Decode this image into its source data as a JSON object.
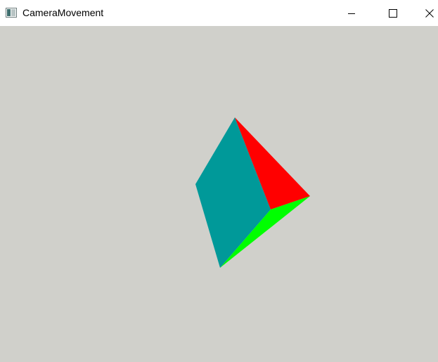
{
  "window": {
    "title": "CameraMovement",
    "icon": "app-window-icon",
    "controls": {
      "minimize": "minimize-icon",
      "maximize": "maximize-icon",
      "close": "close-icon"
    }
  },
  "viewport": {
    "background_color": "#d0d0cb",
    "scene_object": "pyramid",
    "face_colors": {
      "front": "#009999",
      "right": "#ff0000",
      "bottom": "#00ff00"
    }
  }
}
